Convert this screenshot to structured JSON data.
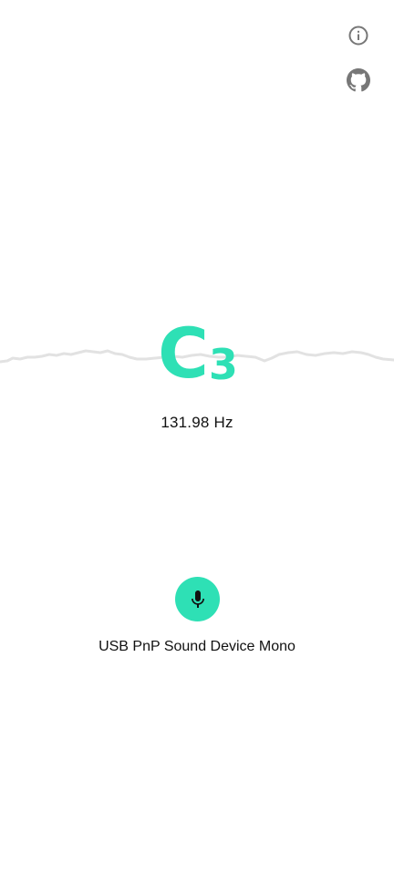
{
  "toolbar": {
    "info_icon": "info-icon",
    "github_icon": "github-icon",
    "icon_color": "#777777"
  },
  "tuner": {
    "note_letter": "C",
    "note_octave": "3",
    "frequency": "131.98 Hz",
    "accent_color": "#2ee0b5",
    "waveform_color": "#e2e2e2"
  },
  "input": {
    "mic_icon": "microphone-icon",
    "device_name": "USB PnP Sound Device Mono"
  }
}
